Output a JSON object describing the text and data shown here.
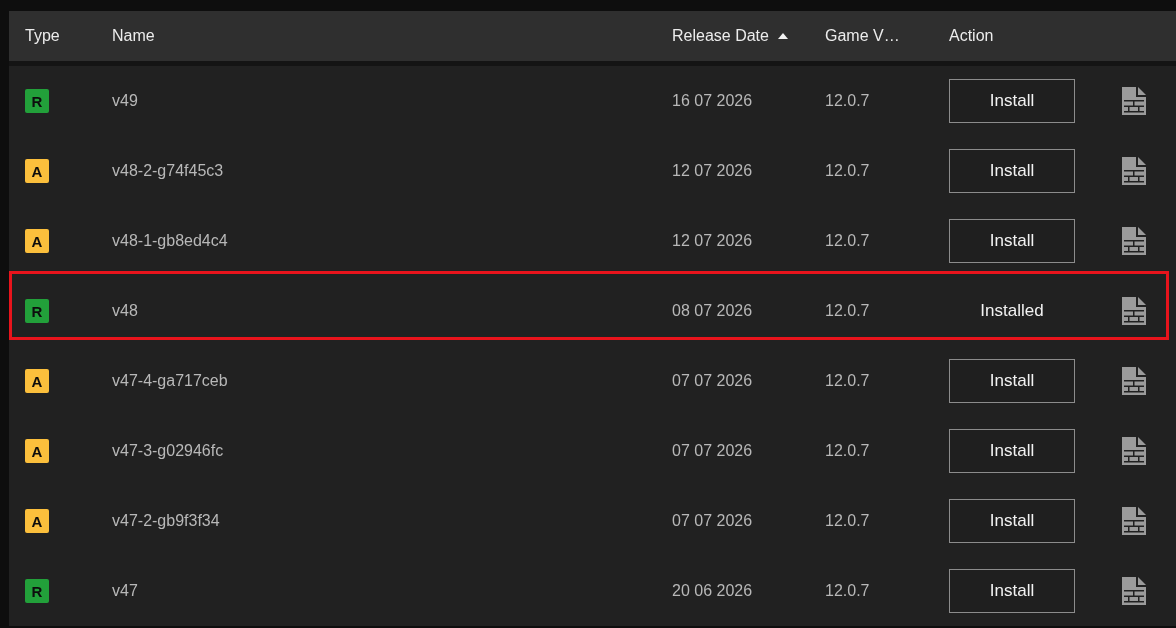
{
  "table": {
    "columns": [
      {
        "label": "Type",
        "sorted": false
      },
      {
        "label": "Name",
        "sorted": false
      },
      {
        "label": "Release Date",
        "sorted": true
      },
      {
        "label": "Game V…",
        "sorted": false
      },
      {
        "label": "Action",
        "sorted": false
      }
    ],
    "rows": [
      {
        "type": {
          "label": "R",
          "color": "#22a03a"
        },
        "name": "v49",
        "release_date": "16 07 2026",
        "game_version": "12.0.7",
        "action": {
          "label": "Install",
          "installed": false
        },
        "highlighted": false
      },
      {
        "type": {
          "label": "A",
          "color": "#fbbf3c"
        },
        "name": "v48-2-g74f45c3",
        "release_date": "12 07 2026",
        "game_version": "12.0.7",
        "action": {
          "label": "Install",
          "installed": false
        },
        "highlighted": false
      },
      {
        "type": {
          "label": "A",
          "color": "#fbbf3c"
        },
        "name": "v48-1-gb8ed4c4",
        "release_date": "12 07 2026",
        "game_version": "12.0.7",
        "action": {
          "label": "Install",
          "installed": false
        },
        "highlighted": false
      },
      {
        "type": {
          "label": "R",
          "color": "#22a03a"
        },
        "name": "v48",
        "release_date": "08 07 2026",
        "game_version": "12.0.7",
        "action": {
          "label": "Installed",
          "installed": true
        },
        "highlighted": true
      },
      {
        "type": {
          "label": "A",
          "color": "#fbbf3c"
        },
        "name": "v47-4-ga717ceb",
        "release_date": "07 07 2026",
        "game_version": "12.0.7",
        "action": {
          "label": "Install",
          "installed": false
        },
        "highlighted": false
      },
      {
        "type": {
          "label": "A",
          "color": "#fbbf3c"
        },
        "name": "v47-3-g02946fc",
        "release_date": "07 07 2026",
        "game_version": "12.0.7",
        "action": {
          "label": "Install",
          "installed": false
        },
        "highlighted": false
      },
      {
        "type": {
          "label": "A",
          "color": "#fbbf3c"
        },
        "name": "v47-2-gb9f3f34",
        "release_date": "07 07 2026",
        "game_version": "12.0.7",
        "action": {
          "label": "Install",
          "installed": false
        },
        "highlighted": false
      },
      {
        "type": {
          "label": "R",
          "color": "#22a03a"
        },
        "name": "v47",
        "release_date": "20 06 2026",
        "game_version": "12.0.7",
        "action": {
          "label": "Install",
          "installed": false
        },
        "highlighted": false
      }
    ]
  }
}
